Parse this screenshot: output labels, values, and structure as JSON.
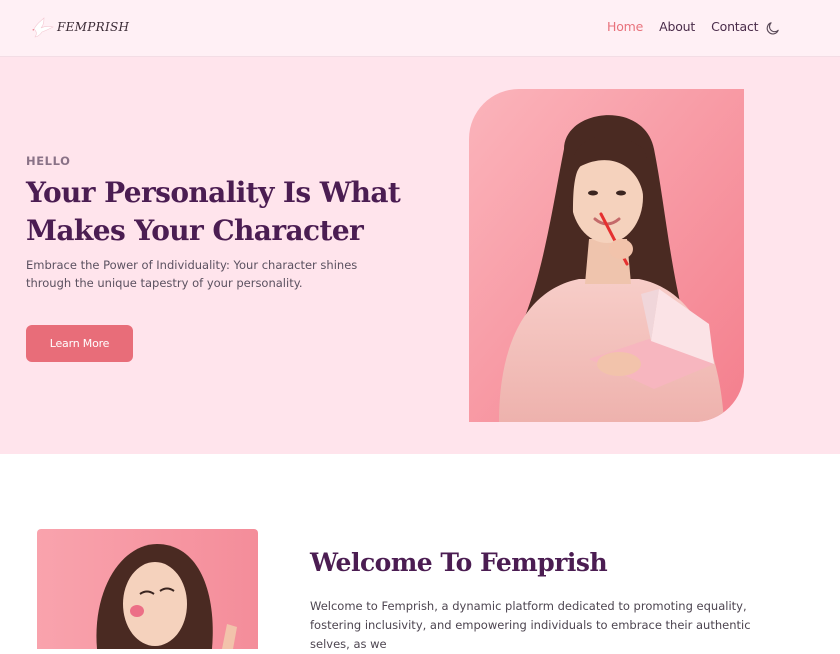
{
  "brand": {
    "name": "FEMPRISH"
  },
  "nav": {
    "links": [
      {
        "label": "Home",
        "active": true
      },
      {
        "label": "About",
        "active": false
      },
      {
        "label": "Contact",
        "active": false
      }
    ],
    "theme_toggle_icon": "moon-icon"
  },
  "hero": {
    "kicker": "HELLO",
    "title": "Your Personality Is What Makes Your Character",
    "description": "Embrace the Power of Individuality: Your character shines through the unique tapestry of your personality.",
    "button_label": "Learn More",
    "image": "woman-holding-notebook-photo"
  },
  "welcome": {
    "title": "Welcome To Femprish",
    "text": "Welcome to Femprish, a dynamic platform dedicated to promoting equality, fostering inclusivity, and empowering individuals to embrace their authentic selves, as we",
    "image": "woman-blowing-kiss-photo"
  },
  "colors": {
    "accent": "#e86d79",
    "heading": "#4b1d52",
    "hero_bg": "#ffe4ec",
    "nav_bg": "#fff0f5"
  }
}
